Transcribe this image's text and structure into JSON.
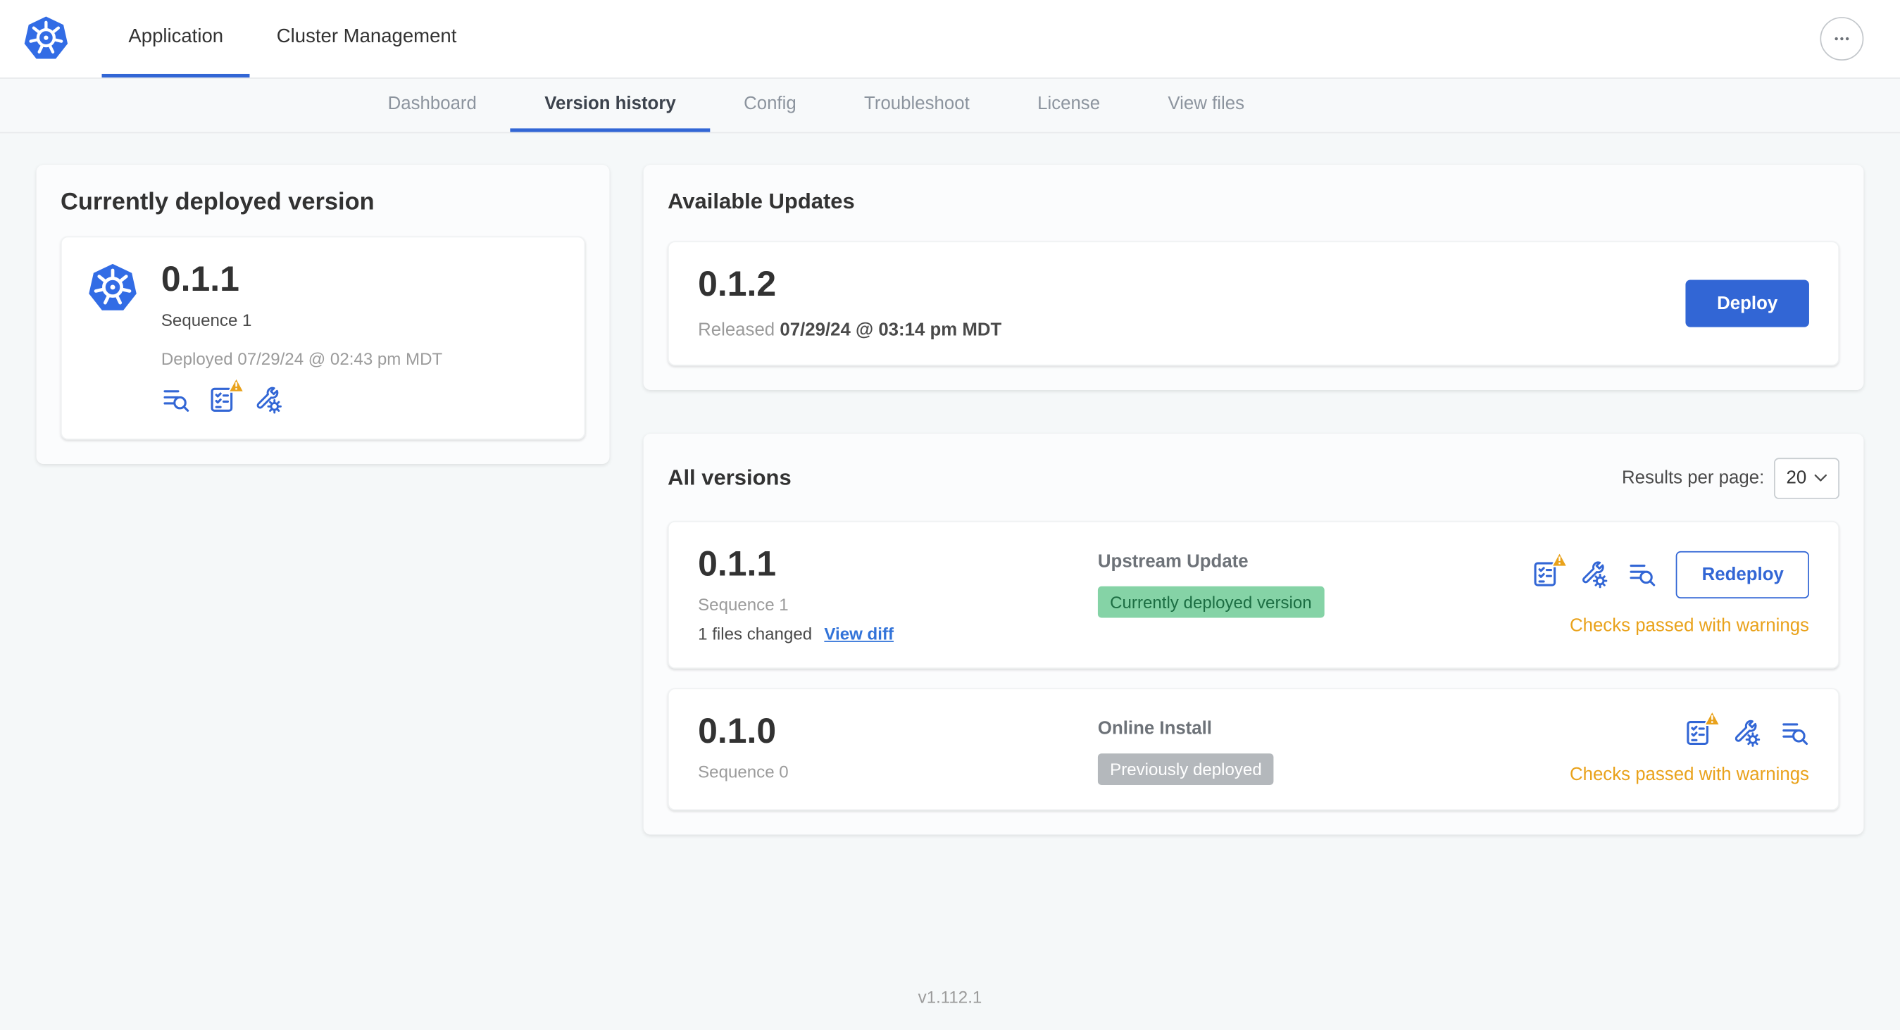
{
  "header": {
    "tabs": [
      {
        "label": "Application",
        "active": true
      },
      {
        "label": "Cluster Management",
        "active": false
      }
    ],
    "overflow_menu_icon": "ellipsis-icon"
  },
  "subnav": {
    "tabs": [
      {
        "label": "Dashboard",
        "active": false
      },
      {
        "label": "Version history",
        "active": true
      },
      {
        "label": "Config",
        "active": false
      },
      {
        "label": "Troubleshoot",
        "active": false
      },
      {
        "label": "License",
        "active": false
      },
      {
        "label": "View files",
        "active": false
      }
    ]
  },
  "deployed_card": {
    "title": "Currently deployed version",
    "version": "0.1.1",
    "sequence": "Sequence 1",
    "deployed_at": "Deployed 07/29/24 @ 02:43 pm MDT",
    "icons": [
      "release-notes-icon",
      "preflight-checks-warning-icon",
      "config-icon"
    ]
  },
  "available_updates": {
    "title": "Available Updates",
    "version": "0.1.2",
    "released_label": "Released",
    "released_date": "07/29/24 @ 03:14 pm MDT",
    "deploy_label": "Deploy"
  },
  "all_versions": {
    "title": "All versions",
    "results_per_page_label": "Results per page:",
    "results_per_page_value": "20",
    "rows": [
      {
        "version": "0.1.1",
        "sequence": "Sequence 1",
        "files_changed": "1 files changed",
        "diff_link": "View diff",
        "source": "Upstream Update",
        "badge": "Currently deployed version",
        "badge_style": "green",
        "icons": [
          "preflight-checks-warning-icon",
          "config-icon",
          "release-notes-icon"
        ],
        "status": "Checks passed with warnings",
        "action_label": "Redeploy"
      },
      {
        "version": "0.1.0",
        "sequence": "Sequence 0",
        "source": "Online Install",
        "badge": "Previously deployed",
        "badge_style": "gray",
        "icons": [
          "preflight-checks-warning-icon",
          "config-icon",
          "release-notes-icon"
        ],
        "status": "Checks passed with warnings"
      }
    ]
  },
  "footer": {
    "version": "v1.112.1"
  },
  "colors": {
    "primary_blue": "#3266d5",
    "link_blue": "#3273d9",
    "kubernetes_blue": "#326ce5",
    "warning_amber": "#e9a21b",
    "badge_green_bg": "#85d3a6",
    "badge_green_text": "#1c6e43",
    "badge_gray_bg": "#b4b8bc",
    "page_background": "#f5f8f9"
  }
}
